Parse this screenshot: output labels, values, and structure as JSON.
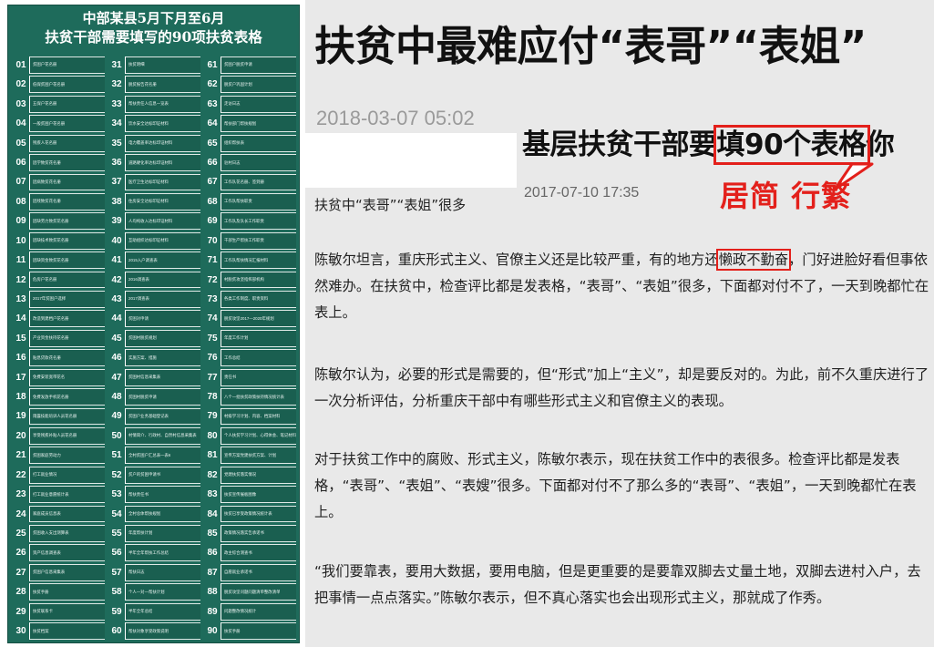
{
  "left": {
    "title_line1": "中部某县5月下月至6月",
    "title_line2": "扶贫干部需要填写的90项扶贫表格",
    "items": [
      {
        "num": "01",
        "text": "贫困户花名册"
      },
      {
        "num": "02",
        "text": "低保贫困户花名册"
      },
      {
        "num": "03",
        "text": "五保户花名册"
      },
      {
        "num": "04",
        "text": "一般贫困户花名册"
      },
      {
        "num": "05",
        "text": "残疾人花名册"
      },
      {
        "num": "06",
        "text": "因学致贫花名册"
      },
      {
        "num": "07",
        "text": "因病致贫花名册"
      },
      {
        "num": "08",
        "text": "因残致贫花名册"
      },
      {
        "num": "09",
        "text": "因缺劳力致贫花名册"
      },
      {
        "num": "10",
        "text": "因缺技术致贫花名册"
      },
      {
        "num": "11",
        "text": "因缺资金致贫花名册"
      },
      {
        "num": "12",
        "text": "危房户花名册"
      },
      {
        "num": "13",
        "text": "2017年贫困户选择"
      },
      {
        "num": "14",
        "text": "改造到建档户花名册"
      },
      {
        "num": "15",
        "text": "产业资金扶持花名册"
      },
      {
        "num": "16",
        "text": "贴息贷款花名册"
      },
      {
        "num": "17",
        "text": "免费安装宽带花名"
      },
      {
        "num": "18",
        "text": "免费发放手机花名册"
      },
      {
        "num": "19",
        "text": "雨露技能培训人员花名册"
      },
      {
        "num": "20",
        "text": "享受残疾补贴人员花名册"
      },
      {
        "num": "21",
        "text": "贫困家庭劳动力"
      },
      {
        "num": "22",
        "text": "打工就业情况"
      },
      {
        "num": "23",
        "text": "打工就业意愿统计表"
      },
      {
        "num": "24",
        "text": "家庭成员信息表"
      },
      {
        "num": "25",
        "text": "贫困收入支出测算表"
      },
      {
        "num": "26",
        "text": "资产信息调查表"
      },
      {
        "num": "27",
        "text": "贫困户信息采集表"
      },
      {
        "num": "28",
        "text": "扶贫手册"
      },
      {
        "num": "29",
        "text": "扶贫联系卡"
      },
      {
        "num": "30",
        "text": "扶贫档案"
      },
      {
        "num": "31",
        "text": "扶贫明细"
      },
      {
        "num": "32",
        "text": "脱贫报告花名册"
      },
      {
        "num": "33",
        "text": "帮扶责任人信息一览表"
      },
      {
        "num": "34",
        "text": "饮水安全达标印证材料"
      },
      {
        "num": "35",
        "text": "电力覆盖率达标印证材料"
      },
      {
        "num": "36",
        "text": "道路硬化率达标印证材料"
      },
      {
        "num": "37",
        "text": "医疗卫生达标印证材料"
      },
      {
        "num": "38",
        "text": "住房安全达标印证材料"
      },
      {
        "num": "39",
        "text": "人均纯收入达标印证材料"
      },
      {
        "num": "40",
        "text": "互助组织达标印证材料"
      },
      {
        "num": "41",
        "text": "2015入户调查表"
      },
      {
        "num": "42",
        "text": "2016调查表"
      },
      {
        "num": "43",
        "text": "2017调查表"
      },
      {
        "num": "44",
        "text": "贫困对申请"
      },
      {
        "num": "45",
        "text": "贫困村脱贫规划"
      },
      {
        "num": "46",
        "text": "实施方案、措施"
      },
      {
        "num": "47",
        "text": "贫困村信息采集表"
      },
      {
        "num": "48",
        "text": "贫困村脱贫申请"
      },
      {
        "num": "49",
        "text": "贫困户业务基础登记表"
      },
      {
        "num": "50",
        "text": "村情简介、行政村、自然村信息采集表"
      },
      {
        "num": "51",
        "text": "全村贫困户汇总表一表6"
      },
      {
        "num": "52",
        "text": "贫户的贫困申请书"
      },
      {
        "num": "53",
        "text": "帮扶责任书"
      },
      {
        "num": "54",
        "text": "全村总体帮扶规划"
      },
      {
        "num": "55",
        "text": "年度帮扶计划"
      },
      {
        "num": "56",
        "text": "半年全年帮扶工作总结"
      },
      {
        "num": "57",
        "text": "帮扶日志"
      },
      {
        "num": "58",
        "text": "个人一对一帮扶计划"
      },
      {
        "num": "59",
        "text": "半年全年总结"
      },
      {
        "num": "60",
        "text": "帮扶对象享受政策说明"
      },
      {
        "num": "61",
        "text": "贫困户脱贫申请"
      },
      {
        "num": "62",
        "text": "脱贫户巩固计划"
      },
      {
        "num": "63",
        "text": "走访日志"
      },
      {
        "num": "64",
        "text": "帮扶部门帮扶规划"
      },
      {
        "num": "65",
        "text": "组织帮扶表"
      },
      {
        "num": "66",
        "text": "驻村日志"
      },
      {
        "num": "67",
        "text": "工作队花名册、签到册"
      },
      {
        "num": "68",
        "text": "工作队帮扶职责"
      },
      {
        "num": "69",
        "text": "工作队及队长工作职责"
      },
      {
        "num": "70",
        "text": "干部生产帮扶工作职责"
      },
      {
        "num": "71",
        "text": "工作队帮扶情况汇报材料"
      },
      {
        "num": "72",
        "text": "村脱贫攻坚指挥部机构"
      },
      {
        "num": "73",
        "text": "各类工作制度、职责资料"
      },
      {
        "num": "74",
        "text": "脱贫攻坚2017—2020年规划"
      },
      {
        "num": "75",
        "text": "年度工作计划"
      },
      {
        "num": "76",
        "text": "工作总结"
      },
      {
        "num": "77",
        "text": "责任书"
      },
      {
        "num": "78",
        "text": "八个一批扶贫政策扶持情况统计表"
      },
      {
        "num": "79",
        "text": "村级学习计划、内容、档案材料"
      },
      {
        "num": "80",
        "text": "个人扶贫学习计划、心得体会、笔记材料"
      },
      {
        "num": "81",
        "text": "宣传方案党建扶贫方案、计划"
      },
      {
        "num": "82",
        "text": "党建扶贫落实情况"
      },
      {
        "num": "83",
        "text": "扶贫宣传展板图像"
      },
      {
        "num": "84",
        "text": "扶贫已享受政策情况统计表"
      },
      {
        "num": "85",
        "text": "政策情况落实告承诺书"
      },
      {
        "num": "86",
        "text": "政主综合测查书"
      },
      {
        "num": "87",
        "text": "自愿就业承诺书"
      },
      {
        "num": "88",
        "text": "脱贫攻坚问题问题清单整改清单"
      },
      {
        "num": "89",
        "text": "问题整改情况统计"
      },
      {
        "num": "90",
        "text": "扶贫手册"
      }
    ]
  },
  "right": {
    "headline": "扶贫中最难应付“表哥”“表姐”",
    "date1": "2018-03-07 05:02",
    "subhead_pre": "基层扶贫干部要",
    "subhead_hl": "填90个表格",
    "subhead_post": "你",
    "date2": "2017-07-10 17:35",
    "callout": "居简 行繁",
    "intro": "扶贫中“表哥”“表姐”很多",
    "p1_pre": "陈敏尔坦言，重庆形式主义、官僚主义还是比较严重，有的地方还",
    "p1_hl": "懒政不勤奋",
    "p1_post": "，门好进脸好看但事依然难办。在扶贫中，检查评比都是发表格，“表哥”、“表姐”很多，下面都对付不了，一天到晚都忙在表上。",
    "p2": "陈敏尔认为，必要的形式是需要的，但“形式”加上“主义”，却是要反对的。为此，前不久重庆进行了一次分析评估，分析重庆干部中有哪些形式主义和官僚主义的表现。",
    "p3": "对于扶贫工作中的腐败、形式主义，陈敏尔表示，现在扶贫工作中的表很多。检查评比都是发表格，“表哥”、“表姐”、“表嫂”很多。下面都对付不了那么多的“表哥”、“表姐”，一天到晚都忙在表上。",
    "p4": "“我们要靠表，要用大数据，要用电脑，但是更重要的是要靠双脚去丈量土地，双脚去进村入户，去把事情一点点落实。”陈敏尔表示，但不真心落实也会出现形式主义，那就成了作秀。",
    "accent_color": "#e3201b",
    "green_color": "#1e6b5b"
  }
}
